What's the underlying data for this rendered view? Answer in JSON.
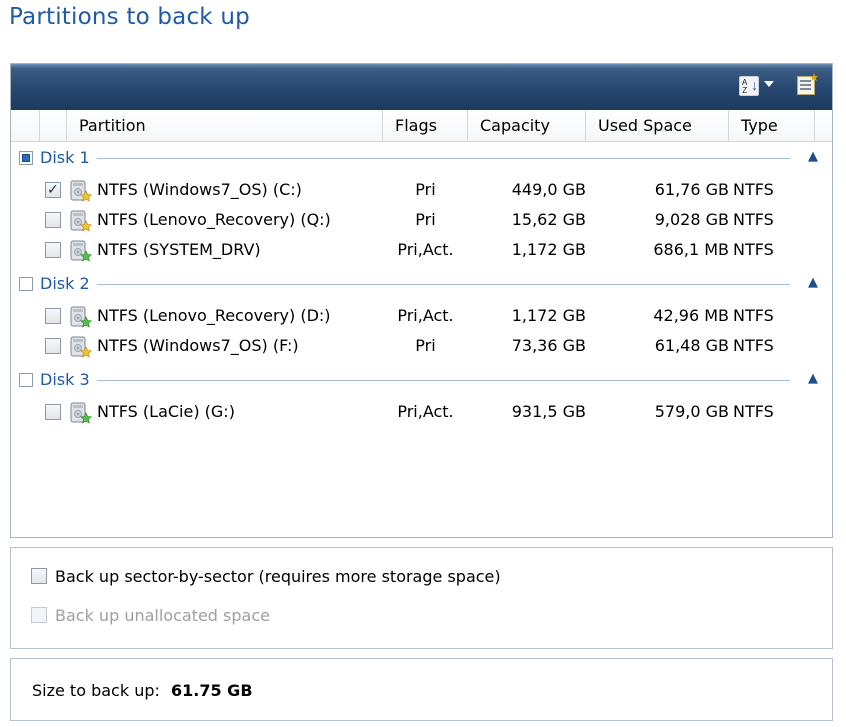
{
  "title": "Partitions to back up",
  "toolbar": {
    "sort_icon": "sort-az-icon",
    "properties_icon": "properties-icon"
  },
  "columns": [
    "Partition",
    "Flags",
    "Capacity",
    "Used Space",
    "Type"
  ],
  "disks": [
    {
      "label": "Disk 1",
      "state": "partial",
      "partitions": [
        {
          "name": "NTFS (Windows7_OS) (C:)",
          "flags": "Pri",
          "capacity": "449,0 GB",
          "used": "61,76 GB",
          "type": "NTFS",
          "checked": true,
          "icon": "disk-partition-star-icon"
        },
        {
          "name": "NTFS (Lenovo_Recovery) (Q:)",
          "flags": "Pri",
          "capacity": "15,62 GB",
          "used": "9,028 GB",
          "type": "NTFS",
          "checked": false,
          "icon": "disk-partition-star-icon"
        },
        {
          "name": "NTFS (SYSTEM_DRV)",
          "flags": "Pri,Act.",
          "capacity": "1,172 GB",
          "used": "686,1 MB",
          "type": "NTFS",
          "checked": false,
          "icon": "disk-partition-active-icon"
        }
      ]
    },
    {
      "label": "Disk 2",
      "state": "unchecked",
      "partitions": [
        {
          "name": "NTFS (Lenovo_Recovery) (D:)",
          "flags": "Pri,Act.",
          "capacity": "1,172 GB",
          "used": "42,96 MB",
          "type": "NTFS",
          "checked": false,
          "icon": "disk-partition-active-icon"
        },
        {
          "name": "NTFS (Windows7_OS) (F:)",
          "flags": "Pri",
          "capacity": "73,36 GB",
          "used": "61,48 GB",
          "type": "NTFS",
          "checked": false,
          "icon": "disk-partition-star-icon"
        }
      ]
    },
    {
      "label": "Disk 3",
      "state": "unchecked",
      "partitions": [
        {
          "name": "NTFS (LaCie) (G:)",
          "flags": "Pri,Act.",
          "capacity": "931,5 GB",
          "used": "579,0 GB",
          "type": "NTFS",
          "checked": false,
          "icon": "disk-partition-active-icon"
        }
      ]
    }
  ],
  "options": {
    "sector_by_sector": {
      "label": "Back up sector-by-sector (requires more storage space)",
      "checked": false,
      "enabled": true
    },
    "unallocated": {
      "label": "Back up unallocated space",
      "checked": false,
      "enabled": false
    }
  },
  "size": {
    "label": "Size to back up:",
    "value": "61.75 GB"
  },
  "colors": {
    "title": "#1e5aa8",
    "toolbar": "#25476f",
    "disk_label": "#1e5aa8"
  }
}
